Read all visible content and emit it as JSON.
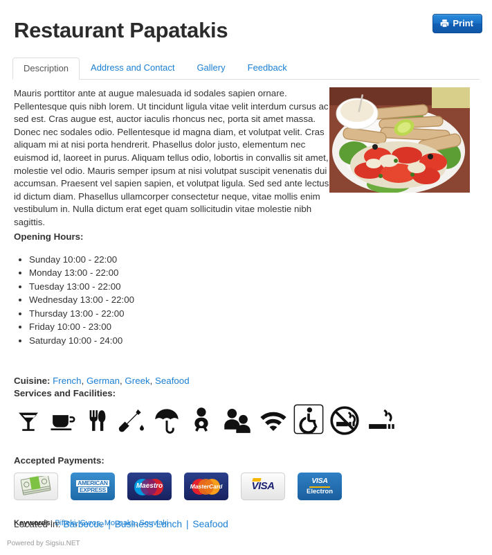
{
  "header": {
    "title": "Restaurant Papatakis",
    "print_label": "Print",
    "print_icon": "printer-icon"
  },
  "tabs": [
    {
      "label": "Description",
      "active": true
    },
    {
      "label": "Address and Contact",
      "active": false
    },
    {
      "label": "Gallery",
      "active": false
    },
    {
      "label": "Feedback",
      "active": false
    }
  ],
  "main": {
    "description": "Mauris porttitor ante at augue malesuada id sodales sapien ornare. Pellentesque quis nibh lorem. Ut tincidunt ligula vitae velit interdum cursus ac sed est. Cras augue est, auctor iaculis rhoncus nec, porta sit amet massa. Donec nec sodales odio. Pellentesque id magna diam, et volutpat velit. Cras aliquam mi at nisi porta hendrerit. Phasellus dolor justo, elementum nec euismod id, laoreet in purus. Aliquam tellus odio, lobortis in convallis sit amet, molestie vel odio. Mauris semper ipsum at nisi volutpat suscipit venenatis dui accumsan. Praesent vel sapien sapien, et volutpat ligula. Sed sed ante lectus, id dictum diam. Phasellus ullamcorper consectetur neque, vitae mollis enim vestibulum in. Nulla dictum erat eget quam sollicitudin vitae molestie nibh sagittis.",
    "photo_alt": "restaurant-dish-photo",
    "opening_hours_label": "Opening Hours:",
    "opening_hours": [
      "Sunday 10:00 - 22:00",
      "Monday 13:00 - 22:00",
      "Tuesday 13:00 - 22:00",
      "Wednesday 13:00 - 22:00",
      "Thursday 13:00 - 22:00",
      "Friday 10:00 - 23:00",
      "Saturday 10:00 - 24:00"
    ],
    "cuisine_label": "Cuisine:",
    "cuisines": [
      "French",
      "German",
      "Greek",
      "Seafood"
    ],
    "facilities_label": "Services and Facilities:",
    "facilities": [
      "cocktail-icon",
      "coffee-cup-icon",
      "fork-knife-icon",
      "wine-bottle-icon",
      "umbrella-icon",
      "baby-icon",
      "group-people-icon",
      "wifi-icon",
      "wheelchair-accessible-icon",
      "no-smoking-icon",
      "smoking-allowed-icon"
    ],
    "payments_label": "Accepted Payments:",
    "payments": [
      {
        "name": "cash-icon",
        "line1": "",
        "line2": ""
      },
      {
        "name": "american-express-icon",
        "line1": "AMERICAN",
        "line2": "EXPRESS"
      },
      {
        "name": "maestro-icon",
        "line1": "Maestro",
        "line2": ""
      },
      {
        "name": "mastercard-icon",
        "line1": "MasterCard",
        "line2": ""
      },
      {
        "name": "visa-icon",
        "line1": "VISA",
        "line2": ""
      },
      {
        "name": "visa-electron-icon",
        "line1": "VISA",
        "line2": "Electron"
      }
    ],
    "keywords_label": "Keywords:",
    "keywords": [
      "Bifteki",
      "Gyros",
      "Mousaka",
      "Souvlaki"
    ]
  },
  "footer": {
    "located_label": "Located in:",
    "categories": [
      "Barbecue",
      "Business Lunch",
      "Seafood"
    ],
    "separator": "|",
    "powered_by": "Powered by Sigsiu.NET"
  },
  "colors": {
    "link": "#1a7fd4",
    "text": "#333333",
    "print_button": "#1a6fc4",
    "muted": "#9a9a9a"
  }
}
